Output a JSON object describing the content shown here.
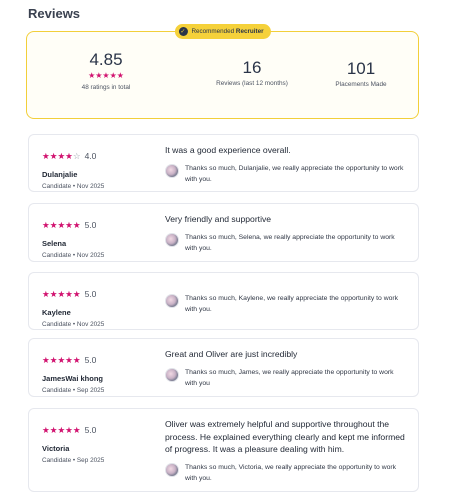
{
  "page": {
    "heading": "Reviews"
  },
  "summary": {
    "badge": {
      "icon": "checkmark-shield-icon",
      "prefix": "Recommended ",
      "strong": "Recruiter"
    },
    "rating": {
      "value": "4.85",
      "stars": 5,
      "count_label": "48 ratings in total"
    },
    "reviews_recent": {
      "value": "16",
      "label": "Reviews (last 12 months)"
    },
    "placements": {
      "value": "101",
      "label": "Placements Made"
    }
  },
  "colors": {
    "star": "#d1126f",
    "badge": "#f5d13a",
    "summary_border": "#f2cf3a"
  },
  "reviews": [
    {
      "rating": "4.0",
      "stars": 4,
      "name": "Dulanjalie",
      "meta": "Candidate • Nov 2025",
      "text": "It was a good experience overall.",
      "reply": "Thanks so much, Dulanjalie, we really appreciate the opportunity to work with you."
    },
    {
      "rating": "5.0",
      "stars": 5,
      "name": "Selena",
      "meta": "Candidate • Nov 2025",
      "text": "Very friendly and supportive",
      "reply": "Thanks so much, Selena, we really appreciate the opportunity to work with you."
    },
    {
      "rating": "5.0",
      "stars": 5,
      "name": "Kaylene",
      "meta": "Candidate • Nov 2025",
      "text": "",
      "reply": "Thanks so much, Kaylene, we really appreciate the opportunity to work with you."
    },
    {
      "rating": "5.0",
      "stars": 5,
      "name": "JamesWai khong",
      "meta": "Candidate • Sep 2025",
      "text": "Great and Oliver are just incredibly",
      "reply": "Thanks so much, James, we really appreciate the opportunity to work with you"
    },
    {
      "rating": "5.0",
      "stars": 5,
      "name": "Victoria",
      "meta": "Candidate • Sep 2025",
      "text": "Oliver was extremely helpful and supportive throughout the process. He explained everything clearly and kept me informed of progress. It was a pleasure dealing with him.",
      "reply": "Thanks so much, Victoria, we really appreciate the opportunity to work with you."
    }
  ]
}
